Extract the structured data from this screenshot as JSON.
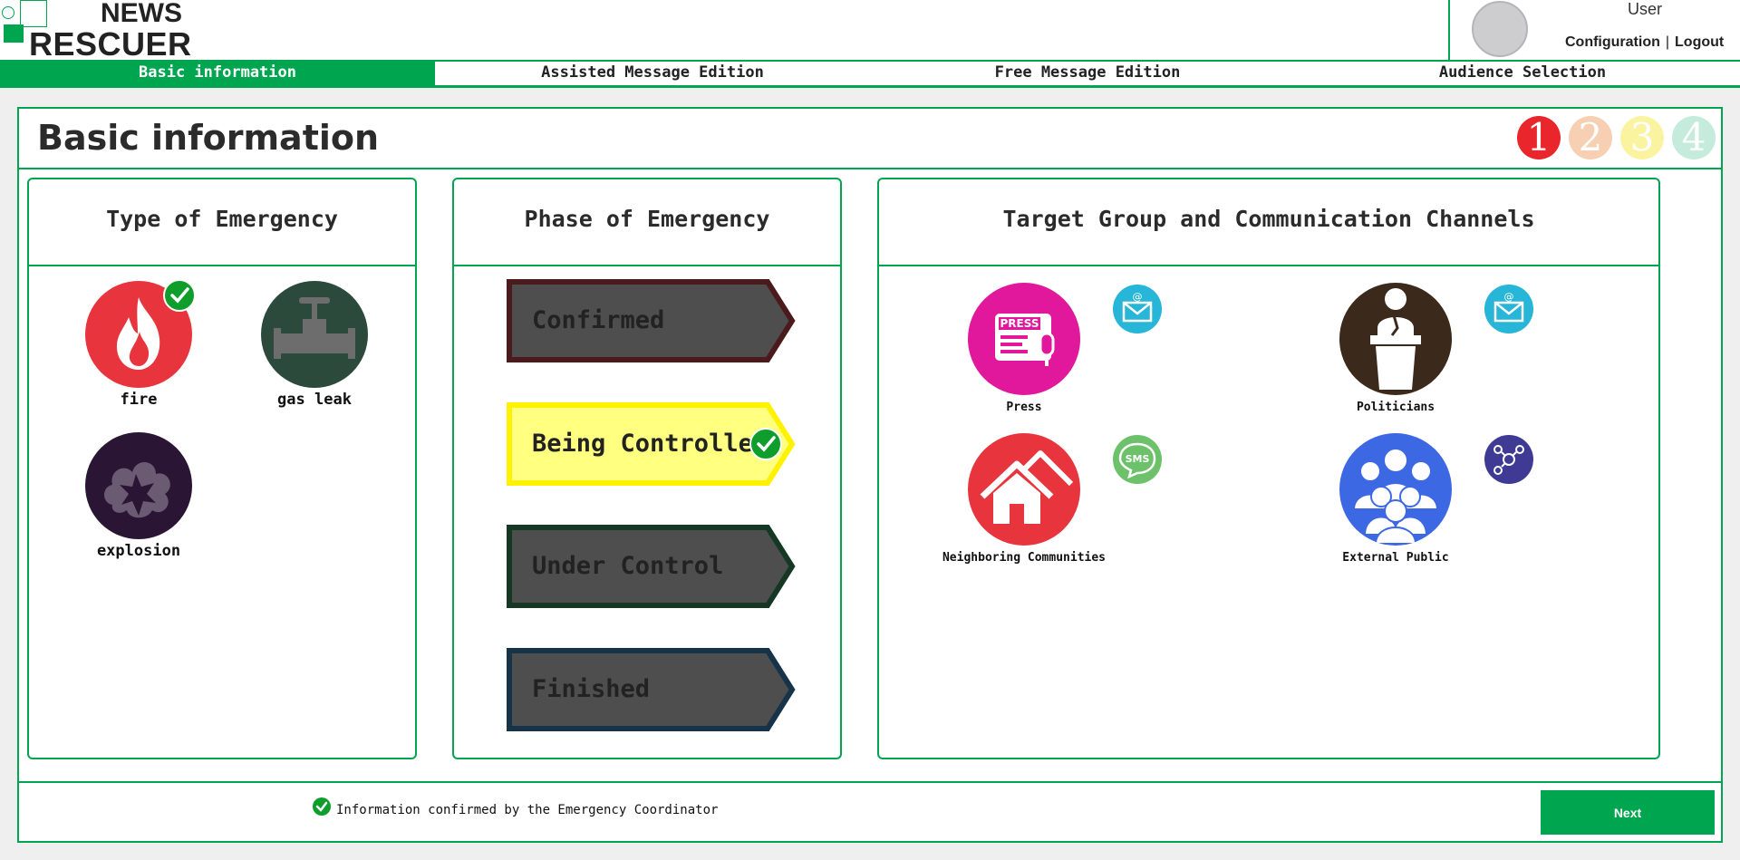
{
  "logo": {
    "line1": "NEWS",
    "line2": "RESCUER"
  },
  "user": {
    "name": "User",
    "configuration_link": "Configuration",
    "separator": "|",
    "logout_link": "Logout"
  },
  "tabs": [
    {
      "label": "Basic information",
      "active": true
    },
    {
      "label": "Assisted Message Edition",
      "active": false
    },
    {
      "label": "Free Message Edition",
      "active": false
    },
    {
      "label": "Audience Selection",
      "active": false
    }
  ],
  "page": {
    "title": "Basic information",
    "steps": [
      {
        "label": "1",
        "color": "#e8262b"
      },
      {
        "label": "2",
        "color": "#f7cfb2"
      },
      {
        "label": "3",
        "color": "#faf3a0"
      },
      {
        "label": "4",
        "color": "#c5ebdd"
      }
    ]
  },
  "emergency_type": {
    "heading": "Type of Emergency",
    "items": [
      {
        "label": "fire",
        "icon": "fire-icon",
        "color": "#e8353d",
        "selected": true
      },
      {
        "label": "gas leak",
        "icon": "valve-icon",
        "color": "#2b4a3c",
        "selected": false
      },
      {
        "label": "explosion",
        "icon": "explosion-icon",
        "color": "#2a1534",
        "selected": false
      }
    ]
  },
  "emergency_phase": {
    "heading": "Phase of Emergency",
    "items": [
      {
        "label": "Confirmed",
        "border": "#4a1a1c",
        "fill": "#4e4e4e",
        "selected": false
      },
      {
        "label": "Being Controlled",
        "border": "#fff200",
        "fill": "#ffff80",
        "selected": true
      },
      {
        "label": "Under Control",
        "border": "#143824",
        "fill": "#4e4e4e",
        "selected": false
      },
      {
        "label": "Finished",
        "border": "#163349",
        "fill": "#4e4e4e",
        "selected": false
      }
    ]
  },
  "target_groups": {
    "heading": "Target Group and Communication Channels",
    "items": [
      {
        "label": "Press",
        "icon": "press-icon",
        "color": "#e1189b",
        "channel": "email-icon",
        "channel_color": "#27b5d8",
        "channel_text": "@"
      },
      {
        "label": "Politicians",
        "icon": "speaker-podium-icon",
        "color": "#3b2a1c",
        "channel": "email-icon",
        "channel_color": "#27b5d8",
        "channel_text": "@"
      },
      {
        "label": "Neighboring Communities",
        "icon": "houses-icon",
        "color": "#e8353d",
        "channel": "sms-icon",
        "channel_color": "#6cc16a",
        "channel_text": "SMS"
      },
      {
        "label": "External Public",
        "icon": "crowd-icon",
        "color": "#3d68e3",
        "channel": "social-network-icon",
        "channel_color": "#3f3b94",
        "channel_text": ""
      }
    ]
  },
  "footer": {
    "confirmation": "Information confirmed by the Emergency Coordinator",
    "next_label": "Next"
  }
}
